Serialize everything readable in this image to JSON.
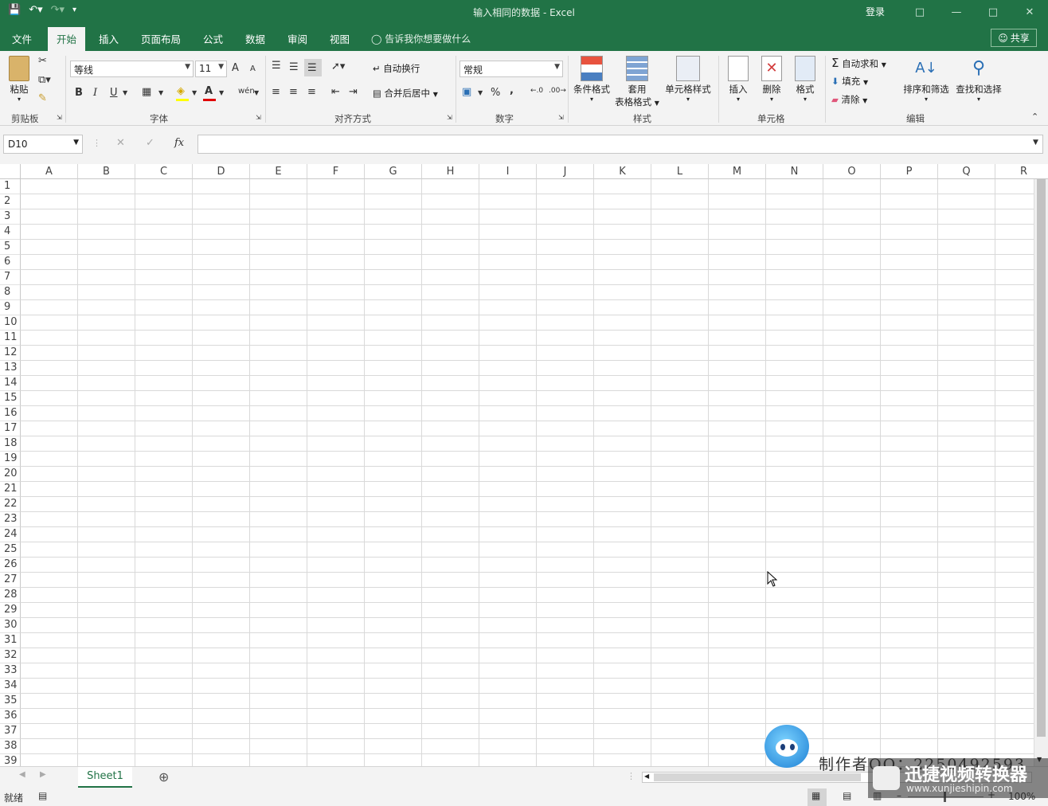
{
  "window": {
    "title": "输入相同的数据  -  Excel",
    "login": "登录"
  },
  "tabs": [
    "文件",
    "开始",
    "插入",
    "页面布局",
    "公式",
    "数据",
    "审阅",
    "视图"
  ],
  "tell_me": "告诉我你想要做什么",
  "share": "共享",
  "clipboard": {
    "paste": "粘贴",
    "label": "剪贴板"
  },
  "font": {
    "name": "等线",
    "size": "11",
    "label": "字体",
    "bold": "B",
    "italic": "I",
    "underline": "U",
    "grow": "A",
    "shrink": "A",
    "color_a": "A",
    "wen": "wén"
  },
  "alignment": {
    "wrap": "自动换行",
    "merge": "合并后居中",
    "label": "对齐方式"
  },
  "number": {
    "format": "常规",
    "label": "数字",
    "percent": "%",
    "comma": ","
  },
  "styles": {
    "cond": "条件格式",
    "table_1": "套用",
    "table_2": "表格格式",
    "cell": "单元格样式",
    "label": "样式"
  },
  "cells": {
    "insert": "插入",
    "delete": "删除",
    "format": "格式",
    "label": "单元格"
  },
  "editing": {
    "autosum": "自动求和",
    "fill": "填充",
    "clear": "清除",
    "sort": "排序和筛选",
    "find": "查找和选择",
    "label": "编辑"
  },
  "namebox": "D10",
  "fx": "fx",
  "columns": [
    "A",
    "B",
    "C",
    "D",
    "E",
    "F",
    "G",
    "H",
    "I",
    "J",
    "K",
    "L",
    "M",
    "N",
    "O",
    "P",
    "Q",
    "R"
  ],
  "rows": [
    "1",
    "2",
    "3",
    "4",
    "5",
    "6",
    "7",
    "8",
    "9",
    "10",
    "11",
    "12",
    "13",
    "14",
    "15",
    "16",
    "17",
    "18",
    "19",
    "20",
    "21",
    "22",
    "23",
    "24",
    "25",
    "26",
    "27",
    "28",
    "29",
    "30",
    "31",
    "32",
    "33",
    "34",
    "35",
    "36",
    "37",
    "38",
    "39"
  ],
  "sheet": "Sheet1",
  "status": {
    "ready": "就绪",
    "zoom": "100%"
  },
  "watermark": {
    "maker": "制作者QQ：2250492593",
    "brand": "迅捷视频转换器",
    "url": "www.xunjieshipin.com"
  },
  "colors": {
    "accent": "#217346",
    "grid": "#d9d9d9"
  }
}
